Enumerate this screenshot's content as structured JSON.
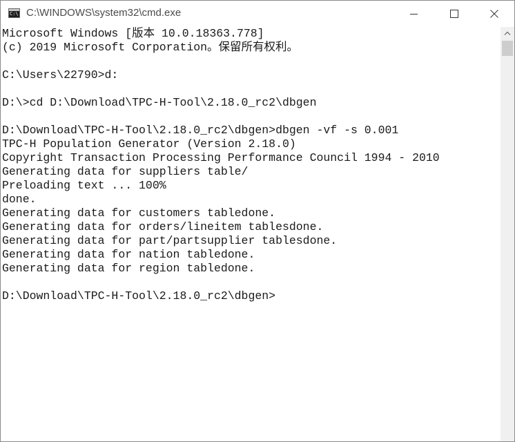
{
  "window": {
    "title": "C:\\WINDOWS\\system32\\cmd.exe",
    "icon": "cmd-icon",
    "icon_glyph": "C:\\",
    "controls": [
      "minimize-icon",
      "maximize-icon",
      "close-icon"
    ]
  },
  "console": {
    "lines": [
      "Microsoft Windows [版本 10.0.18363.778]",
      "(c) 2019 Microsoft Corporation。保留所有权利。",
      "",
      "C:\\Users\\22790>d:",
      "",
      "D:\\>cd D:\\Download\\TPC-H-Tool\\2.18.0_rc2\\dbgen",
      "",
      "D:\\Download\\TPC-H-Tool\\2.18.0_rc2\\dbgen>dbgen -vf -s 0.001",
      "TPC-H Population Generator (Version 2.18.0)",
      "Copyright Transaction Processing Performance Council 1994 - 2010",
      "Generating data for suppliers table/",
      "Preloading text ... 100%",
      "done.",
      "Generating data for customers tabledone.",
      "Generating data for orders/lineitem tablesdone.",
      "Generating data for part/partsupplier tablesdone.",
      "Generating data for nation tabledone.",
      "Generating data for region tabledone.",
      "",
      "D:\\Download\\TPC-H-Tool\\2.18.0_rc2\\dbgen>"
    ]
  },
  "colors": {
    "background": "#ffffff",
    "text": "#1a1a1a",
    "scrollbar_track": "#f0f0f0",
    "scrollbar_thumb": "#cdcdcd"
  }
}
